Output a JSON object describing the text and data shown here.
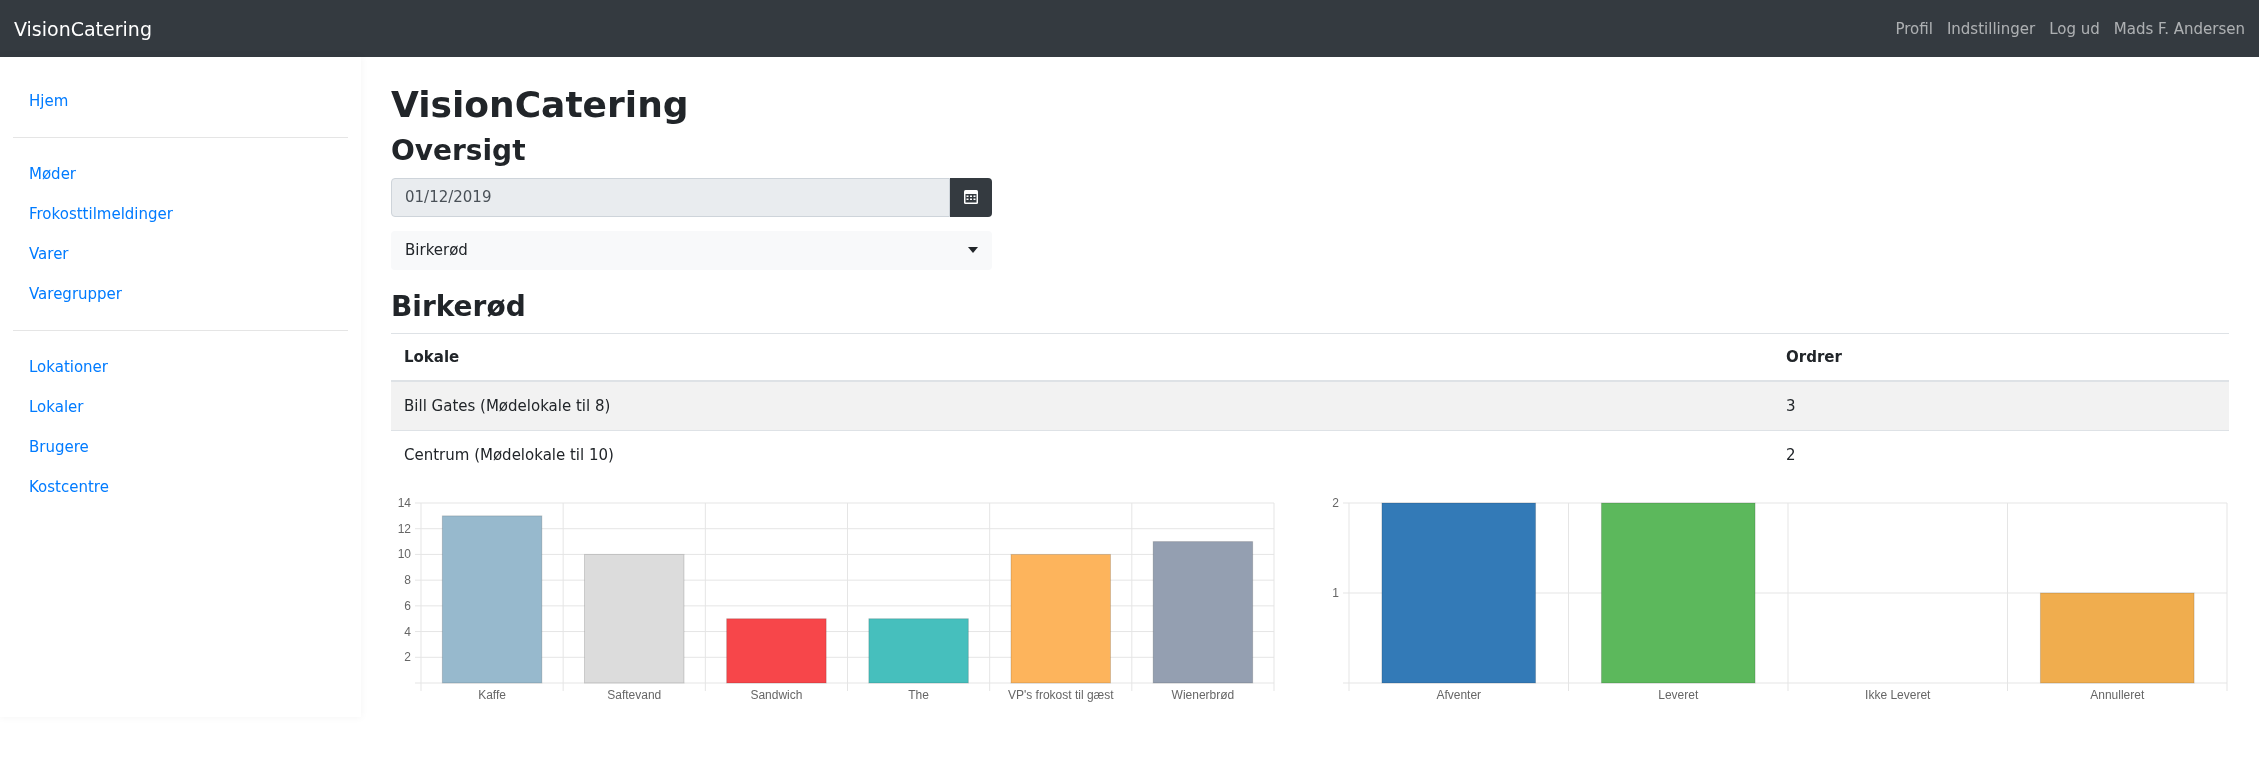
{
  "navbar": {
    "brand": "VisionCatering",
    "links": [
      "Profil",
      "Indstillinger",
      "Log ud",
      "Mads F. Andersen"
    ]
  },
  "sidebar": {
    "groups": [
      [
        "Hjem"
      ],
      [
        "Møder",
        "Frokosttilmeldinger",
        "Varer",
        "Varegrupper"
      ],
      [
        "Lokationer",
        "Lokaler",
        "Brugere",
        "Kostcentre"
      ]
    ]
  },
  "main": {
    "title": "VisionCatering",
    "subtitle": "Oversigt",
    "date_field": {
      "value": "01/12/2019"
    },
    "location_select": {
      "value": "Birkerød"
    },
    "section_title": "Birkerød",
    "table": {
      "columns": [
        "Lokale",
        "Ordrer"
      ],
      "rows": [
        {
          "cells": [
            "Bill Gates (Mødelokale til 8)",
            "3"
          ],
          "striped": true
        },
        {
          "cells": [
            "Centrum (Mødelokale til 10)",
            "2"
          ],
          "striped": false
        }
      ]
    },
    "charts": [
      {
        "chart_data": {
          "type": "bar",
          "categories": [
            "Kaffe",
            "Saftevand",
            "Sandwich",
            "The",
            "VP's frokost til gæst",
            "Wienerbrød"
          ],
          "values": [
            13,
            10,
            5,
            5,
            10,
            11
          ],
          "colors": [
            "#97b9cd",
            "#dcdcdc",
            "#f7464a",
            "#46bfbd",
            "#fdb45c",
            "#949fb1"
          ],
          "ylim": [
            0,
            14
          ],
          "yticks": [
            2,
            4,
            6,
            8,
            10,
            12,
            14
          ],
          "grid": true
        }
      },
      {
        "chart_data": {
          "type": "bar",
          "categories": [
            "Afventer",
            "Leveret",
            "Ikke Leveret",
            "Annulleret"
          ],
          "values": [
            2,
            2,
            0,
            1
          ],
          "colors": [
            "#337ab7",
            "#5cb85c",
            null,
            "#f0ad4e"
          ],
          "ylim": [
            0,
            2
          ],
          "yticks": [
            1,
            2
          ],
          "grid": true
        }
      }
    ]
  }
}
